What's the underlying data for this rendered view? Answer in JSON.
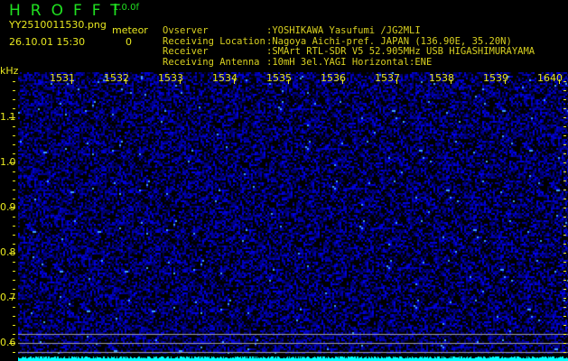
{
  "app": {
    "title": "HROFFT",
    "version": "1.0.0f"
  },
  "file": {
    "name": "YY2510011530.png",
    "datetime": "26.10.01 15:30"
  },
  "meteor": {
    "label": "meteor",
    "count": "0"
  },
  "info": [
    {
      "label": "Ovserver",
      "value": ":YOSHIKAWA Yasufumi /JG2MLI"
    },
    {
      "label": "Receiving Location",
      "value": ":Nagoya Aichi-pref. JAPAN (136.90E, 35.20N)"
    },
    {
      "label": "Receiver",
      "value": ":SMArt RTL-SDR V5 52.905MHz USB HIGASHIMURAYAMA"
    },
    {
      "label": "Receiving Antenna",
      "value": ":10mH 3el.YAGI Horizontal:ENE"
    }
  ],
  "axis": {
    "y_unit": "kHz",
    "y_labels": [
      "1.1",
      "1.0",
      "0.9",
      "0.8",
      "0.7",
      "0.6"
    ],
    "freq_labels": [
      "1531",
      "1532",
      "1533",
      "1534",
      "1535",
      "1536",
      "1537",
      "1538",
      "1539",
      "1640"
    ]
  },
  "colors": {
    "text": "#e8e820",
    "title": "#20e020",
    "noise": "#1a1ad0",
    "signal_strip": "#00ffff",
    "marker_lines": "#a0a0a0"
  }
}
